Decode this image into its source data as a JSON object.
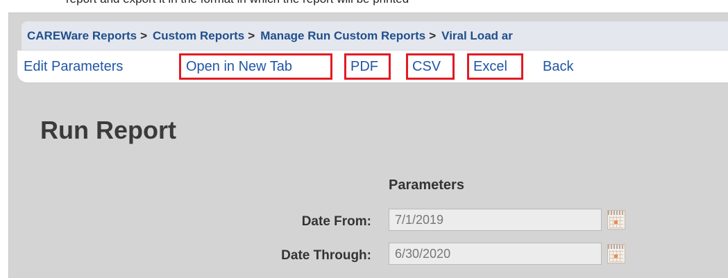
{
  "caption_fragment": "report and export it in the format in which the report will be printed",
  "breadcrumb": {
    "items": [
      "CAREWare Reports",
      "Custom Reports",
      "Manage Run Custom Reports",
      "Viral Load ar"
    ],
    "separator": ">"
  },
  "actions": {
    "edit_parameters": "Edit Parameters",
    "open_in_new_tab": "Open in New Tab",
    "pdf": "PDF",
    "csv": "CSV",
    "excel": "Excel",
    "back": "Back"
  },
  "page": {
    "title": "Run Report",
    "parameters_heading": "Parameters"
  },
  "form": {
    "date_from_label": "Date From:",
    "date_from_value": "7/1/2019",
    "date_through_label": "Date Through:",
    "date_through_value": "6/30/2020"
  },
  "icons": {
    "calendar": "calendar-icon"
  },
  "colors": {
    "link": "#1f55a5",
    "breadcrumb_text": "#1f4f8c",
    "highlight_box": "#e11b22",
    "page_background": "#d4d4d4",
    "breadcrumb_background": "#e4e7ee"
  }
}
